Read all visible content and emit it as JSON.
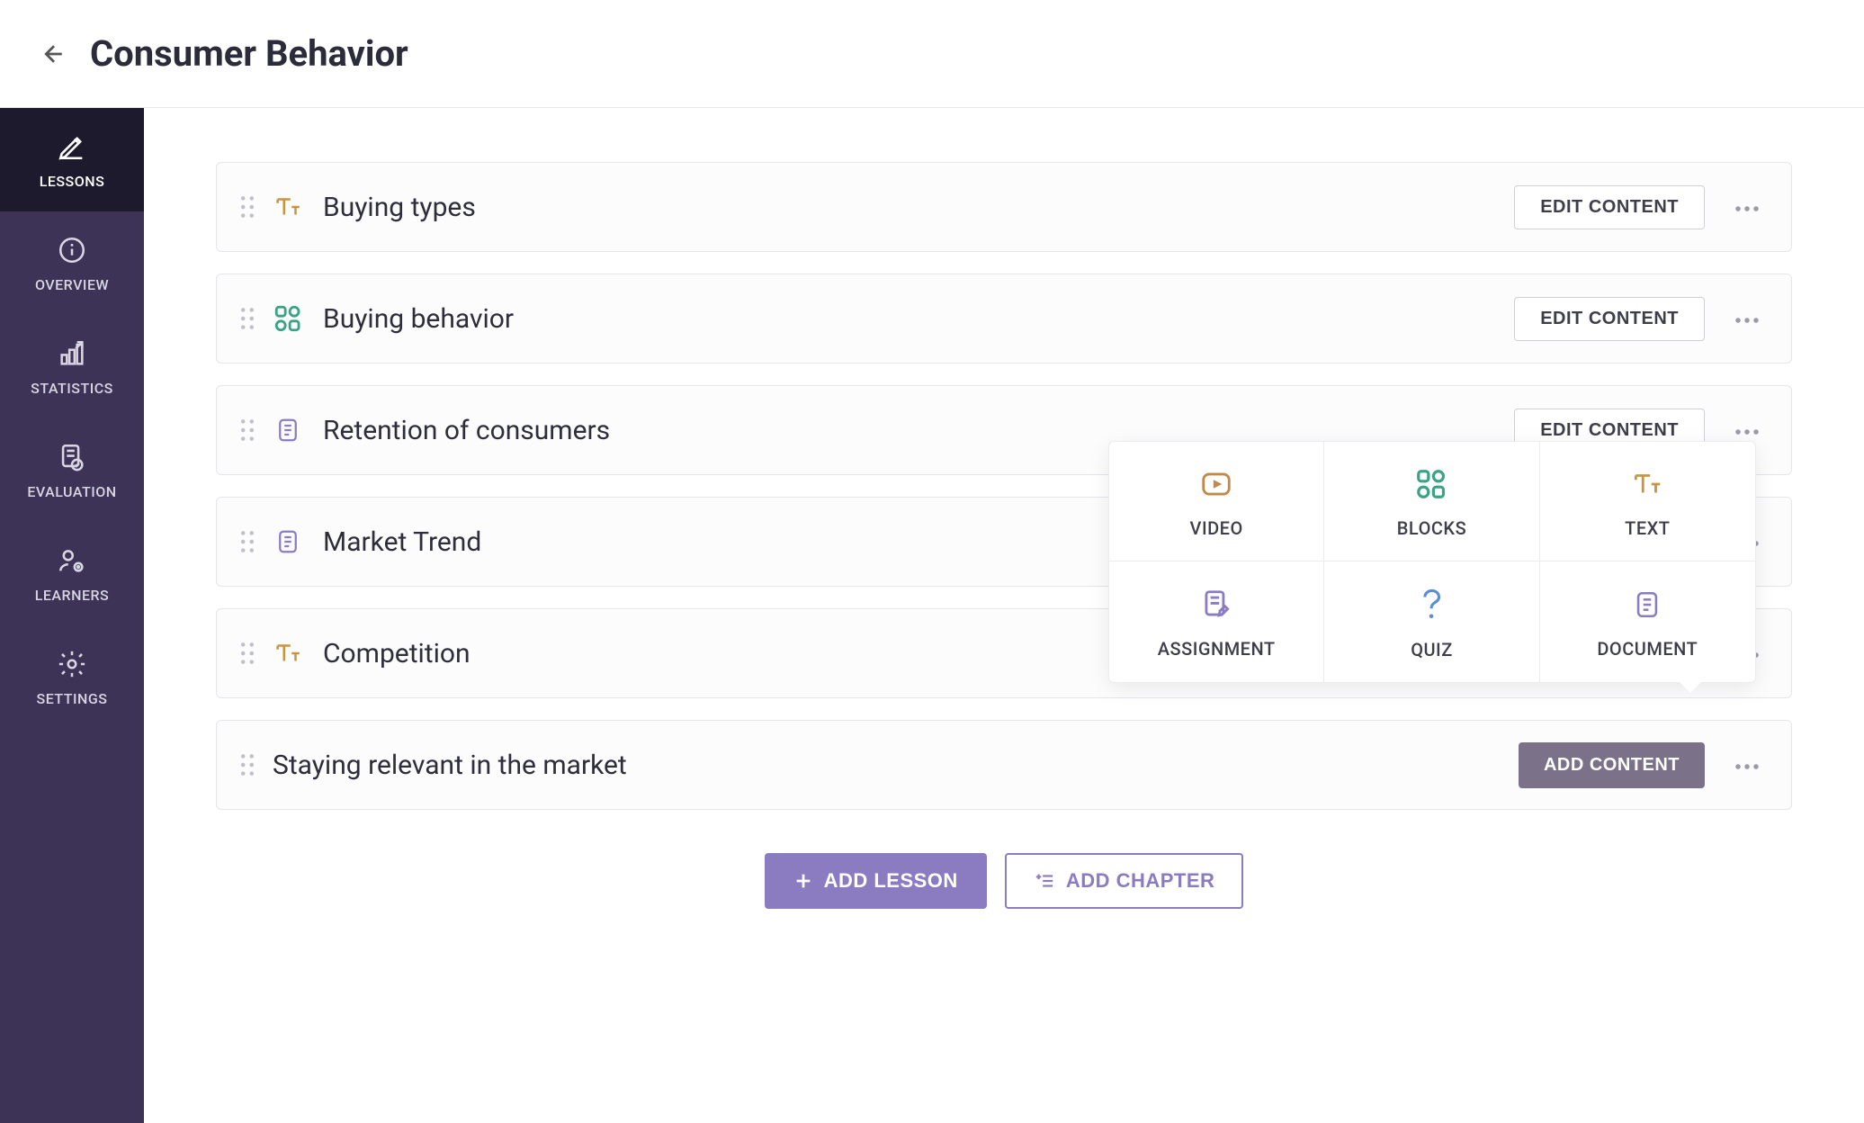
{
  "header": {
    "title": "Consumer Behavior"
  },
  "sidebar": {
    "items": [
      {
        "label": "LESSONS",
        "icon": "pencil-icon",
        "active": true
      },
      {
        "label": "OVERVIEW",
        "icon": "info-icon",
        "active": false
      },
      {
        "label": "STATISTICS",
        "icon": "stats-icon",
        "active": false
      },
      {
        "label": "EVALUATION",
        "icon": "evaluation-icon",
        "active": false
      },
      {
        "label": "LEARNERS",
        "icon": "learners-icon",
        "active": false
      },
      {
        "label": "SETTINGS",
        "icon": "gear-icon",
        "active": false
      }
    ]
  },
  "lessons": [
    {
      "title": "Buying types",
      "type_icon": "text-icon",
      "action": "edit"
    },
    {
      "title": "Buying behavior",
      "type_icon": "blocks-icon",
      "action": "edit"
    },
    {
      "title": "Retention of consumers",
      "type_icon": "document-icon",
      "action": "edit"
    },
    {
      "title": "Market Trend",
      "type_icon": "document-icon",
      "action": "edit"
    },
    {
      "title": "Competition",
      "type_icon": "text-icon",
      "action": "edit"
    },
    {
      "title": "Staying relevant in the market",
      "type_icon": "none",
      "action": "add"
    }
  ],
  "buttons": {
    "edit_content": "EDIT CONTENT",
    "add_content": "ADD CONTENT",
    "add_lesson": "ADD LESSON",
    "add_chapter": "ADD CHAPTER"
  },
  "popover": {
    "options": [
      {
        "label": "VIDEO",
        "icon": "video-icon"
      },
      {
        "label": "BLOCKS",
        "icon": "blocks-icon"
      },
      {
        "label": "TEXT",
        "icon": "text-icon"
      },
      {
        "label": "ASSIGNMENT",
        "icon": "assignment-icon"
      },
      {
        "label": "QUIZ",
        "icon": "quiz-icon"
      },
      {
        "label": "DOCUMENT",
        "icon": "document-icon"
      }
    ]
  }
}
